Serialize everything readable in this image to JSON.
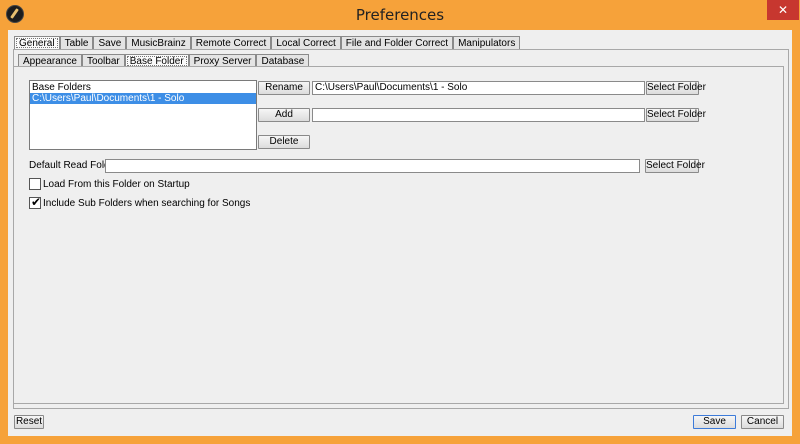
{
  "window": {
    "title": "Preferences",
    "close_glyph": "✕"
  },
  "main_tabs": [
    {
      "label": "General"
    },
    {
      "label": "Table"
    },
    {
      "label": "Save"
    },
    {
      "label": "MusicBrainz"
    },
    {
      "label": "Remote Correct"
    },
    {
      "label": "Local Correct"
    },
    {
      "label": "File and Folder Correct"
    },
    {
      "label": "Manipulators"
    }
  ],
  "sub_tabs": [
    {
      "label": "Appearance"
    },
    {
      "label": "Toolbar"
    },
    {
      "label": "Base Folder"
    },
    {
      "label": "Proxy Server"
    },
    {
      "label": "Database"
    }
  ],
  "base_folders": {
    "header": "Base Folders",
    "items": [
      "C:\\Users\\Paul\\Documents\\1 - Solo"
    ],
    "rename_label": "Rename",
    "add_label": "Add",
    "delete_label": "Delete",
    "rename_value": "C:\\Users\\Paul\\Documents\\1 - Solo",
    "add_value": "",
    "select_folder_label": "Select Folder"
  },
  "default_read": {
    "label": "Default Read Folder",
    "value": "",
    "select_folder_label": "Select Folder"
  },
  "options": {
    "load_on_startup": {
      "label": "Load From this Folder on Startup",
      "checked": false
    },
    "include_sub_folders": {
      "label": "Include Sub Folders when searching for Songs",
      "checked": true,
      "glyph": "✔"
    }
  },
  "footer": {
    "reset_label": "Reset",
    "save_label": "Save",
    "cancel_label": "Cancel"
  },
  "colors": {
    "title_bar": "#f6a23a",
    "close_button": "#c7372f",
    "selection": "#3d8ee6"
  }
}
